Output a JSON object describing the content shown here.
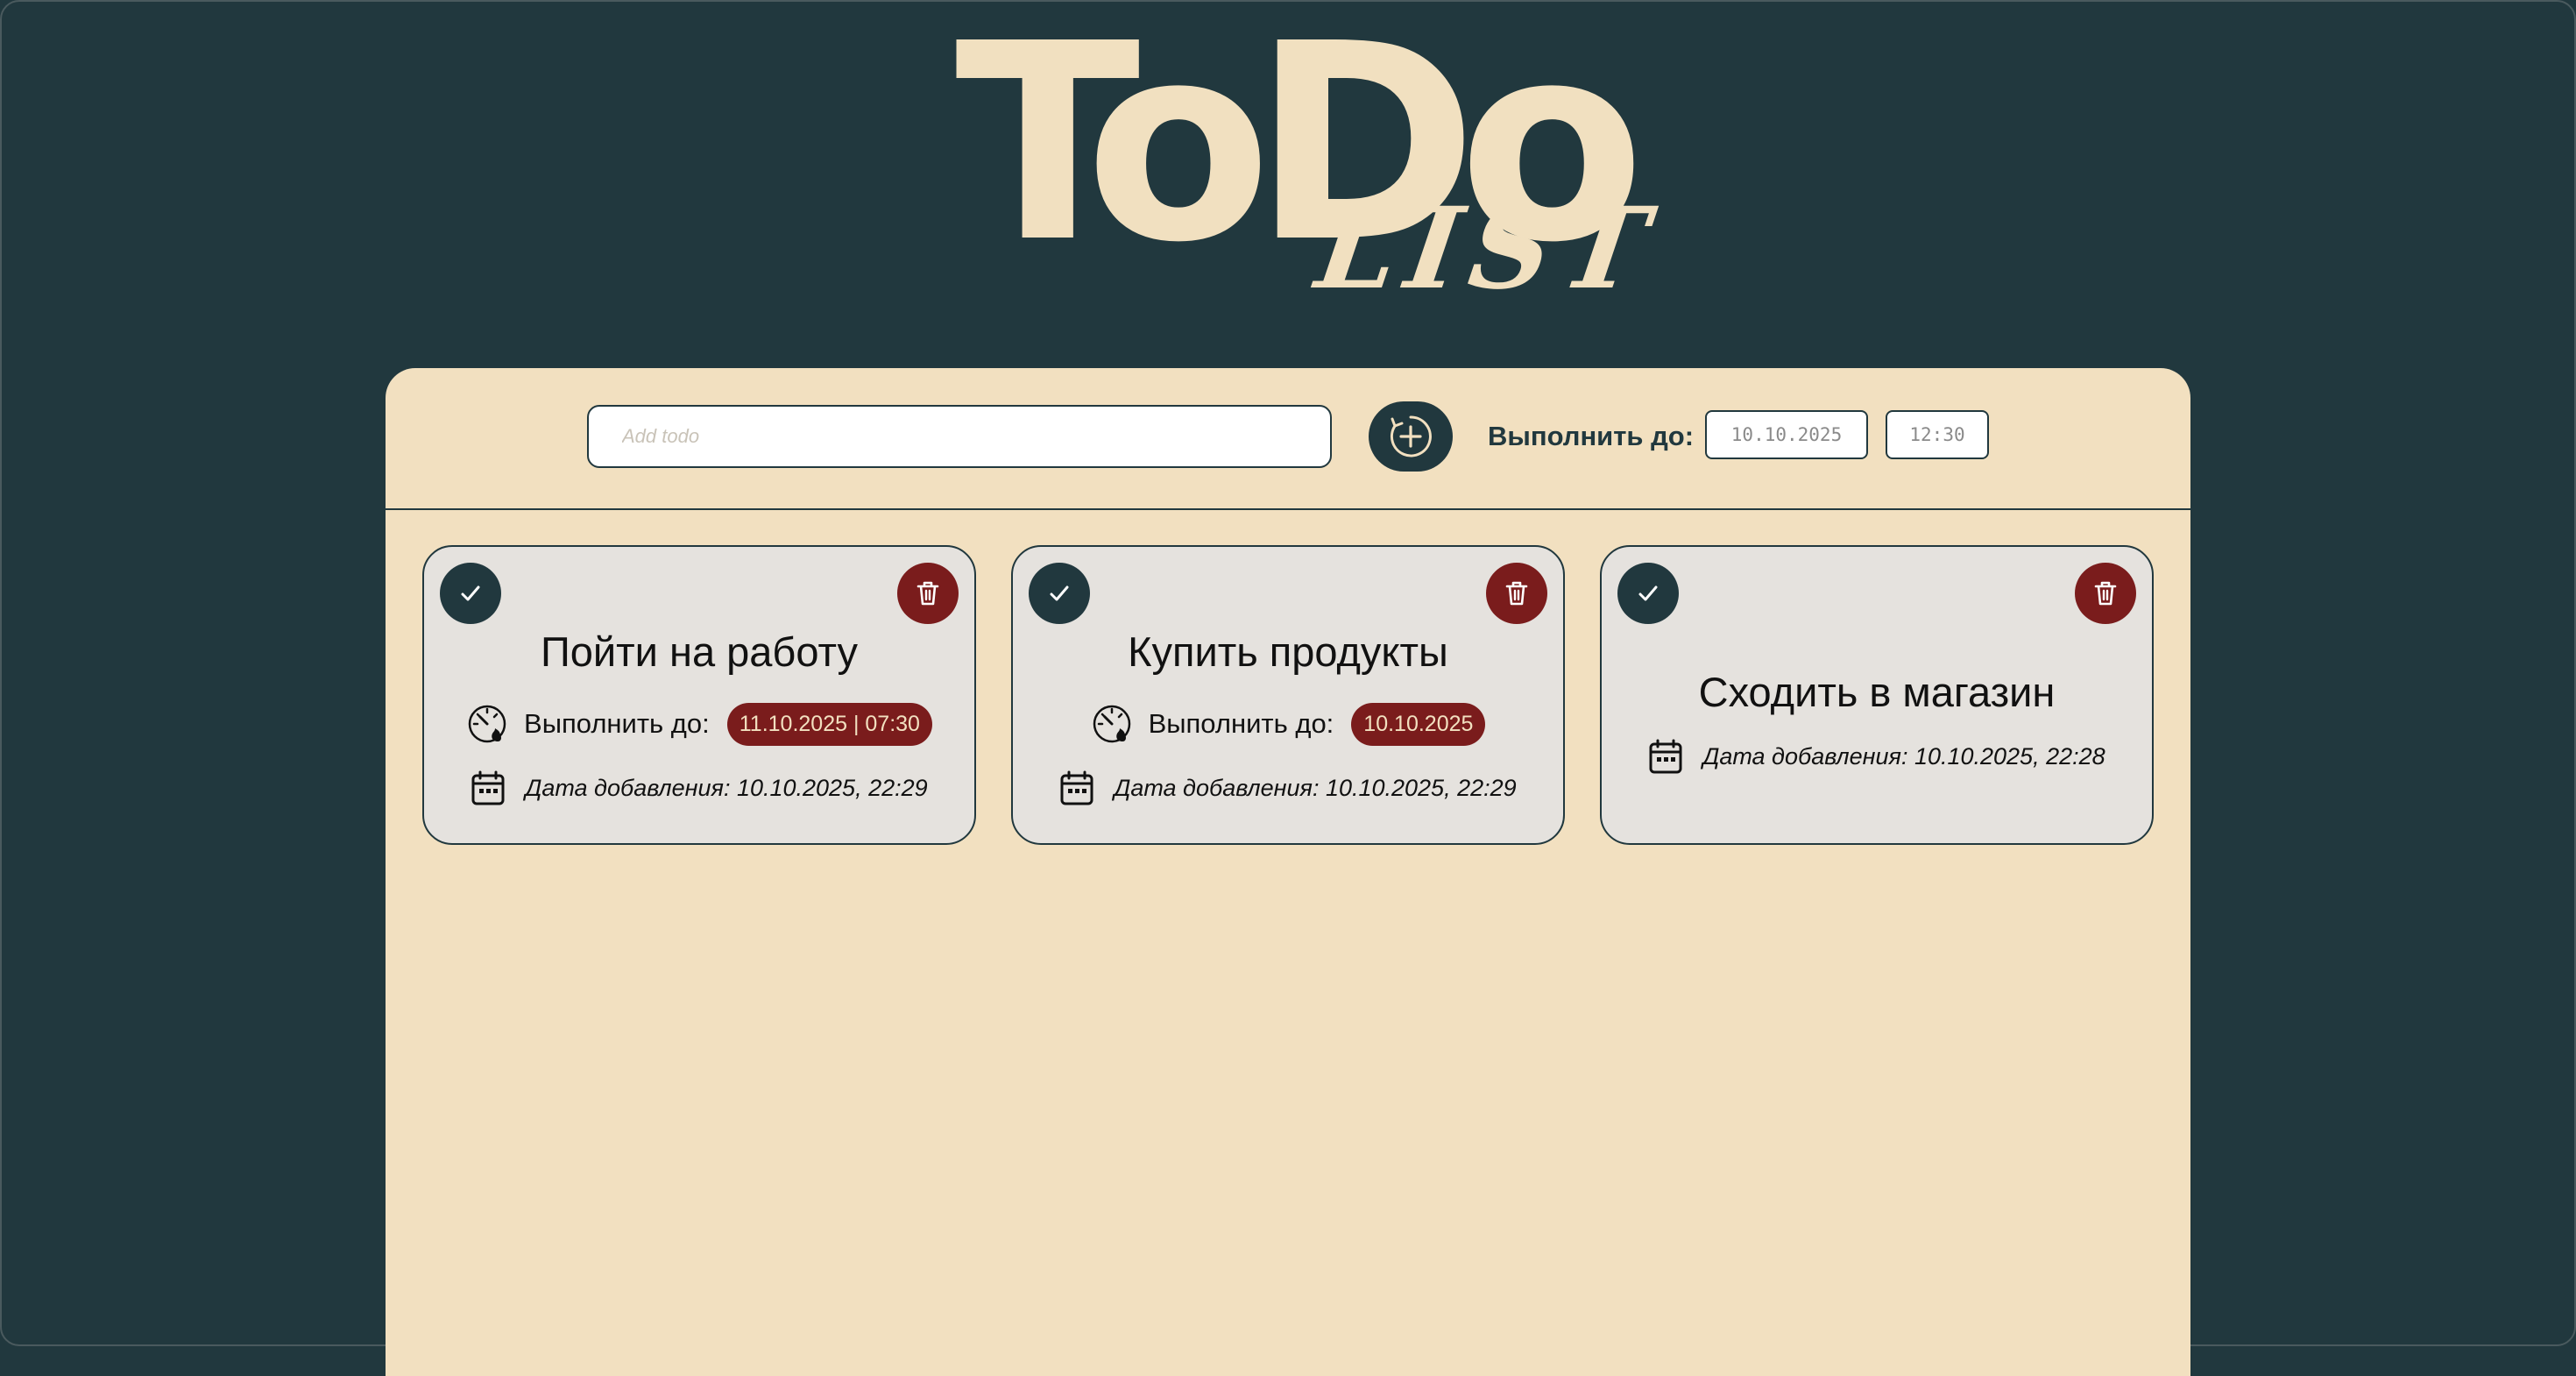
{
  "logo": {
    "main": "ToDo",
    "sub": "LIST"
  },
  "toolbar": {
    "input_placeholder": "Add todo",
    "input_value": "",
    "add_icon": "plus-circle-icon",
    "deadline_label": "Выполнить до:",
    "date_value": "10.10.2025",
    "time_value": "12:30"
  },
  "todos": [
    {
      "title": "Пойти на работу",
      "deadline_label": "Выполнить до:",
      "deadline": "11.10.2025 | 07:30",
      "added": "Дата добавления: 10.10.2025, 22:29",
      "has_deadline": true
    },
    {
      "title": "Купить продукты",
      "deadline_label": "Выполнить до:",
      "deadline": "10.10.2025",
      "added": "Дата добавления: 10.10.2025, 22:29",
      "has_deadline": true
    },
    {
      "title": "Сходить в магазин",
      "added": "Дата добавления: 10.10.2025, 22:28",
      "has_deadline": false
    }
  ],
  "icons": {
    "check": "check-icon",
    "delete": "trash-icon",
    "deadline": "timer-flame-icon",
    "added": "calendar-icon"
  },
  "colors": {
    "background": "#21383e",
    "panel": "#f2e0c0",
    "card": "#e5e2de",
    "accent_dark": "#21383e",
    "danger": "#7a1c1c",
    "logo": "#f1e0c0"
  }
}
